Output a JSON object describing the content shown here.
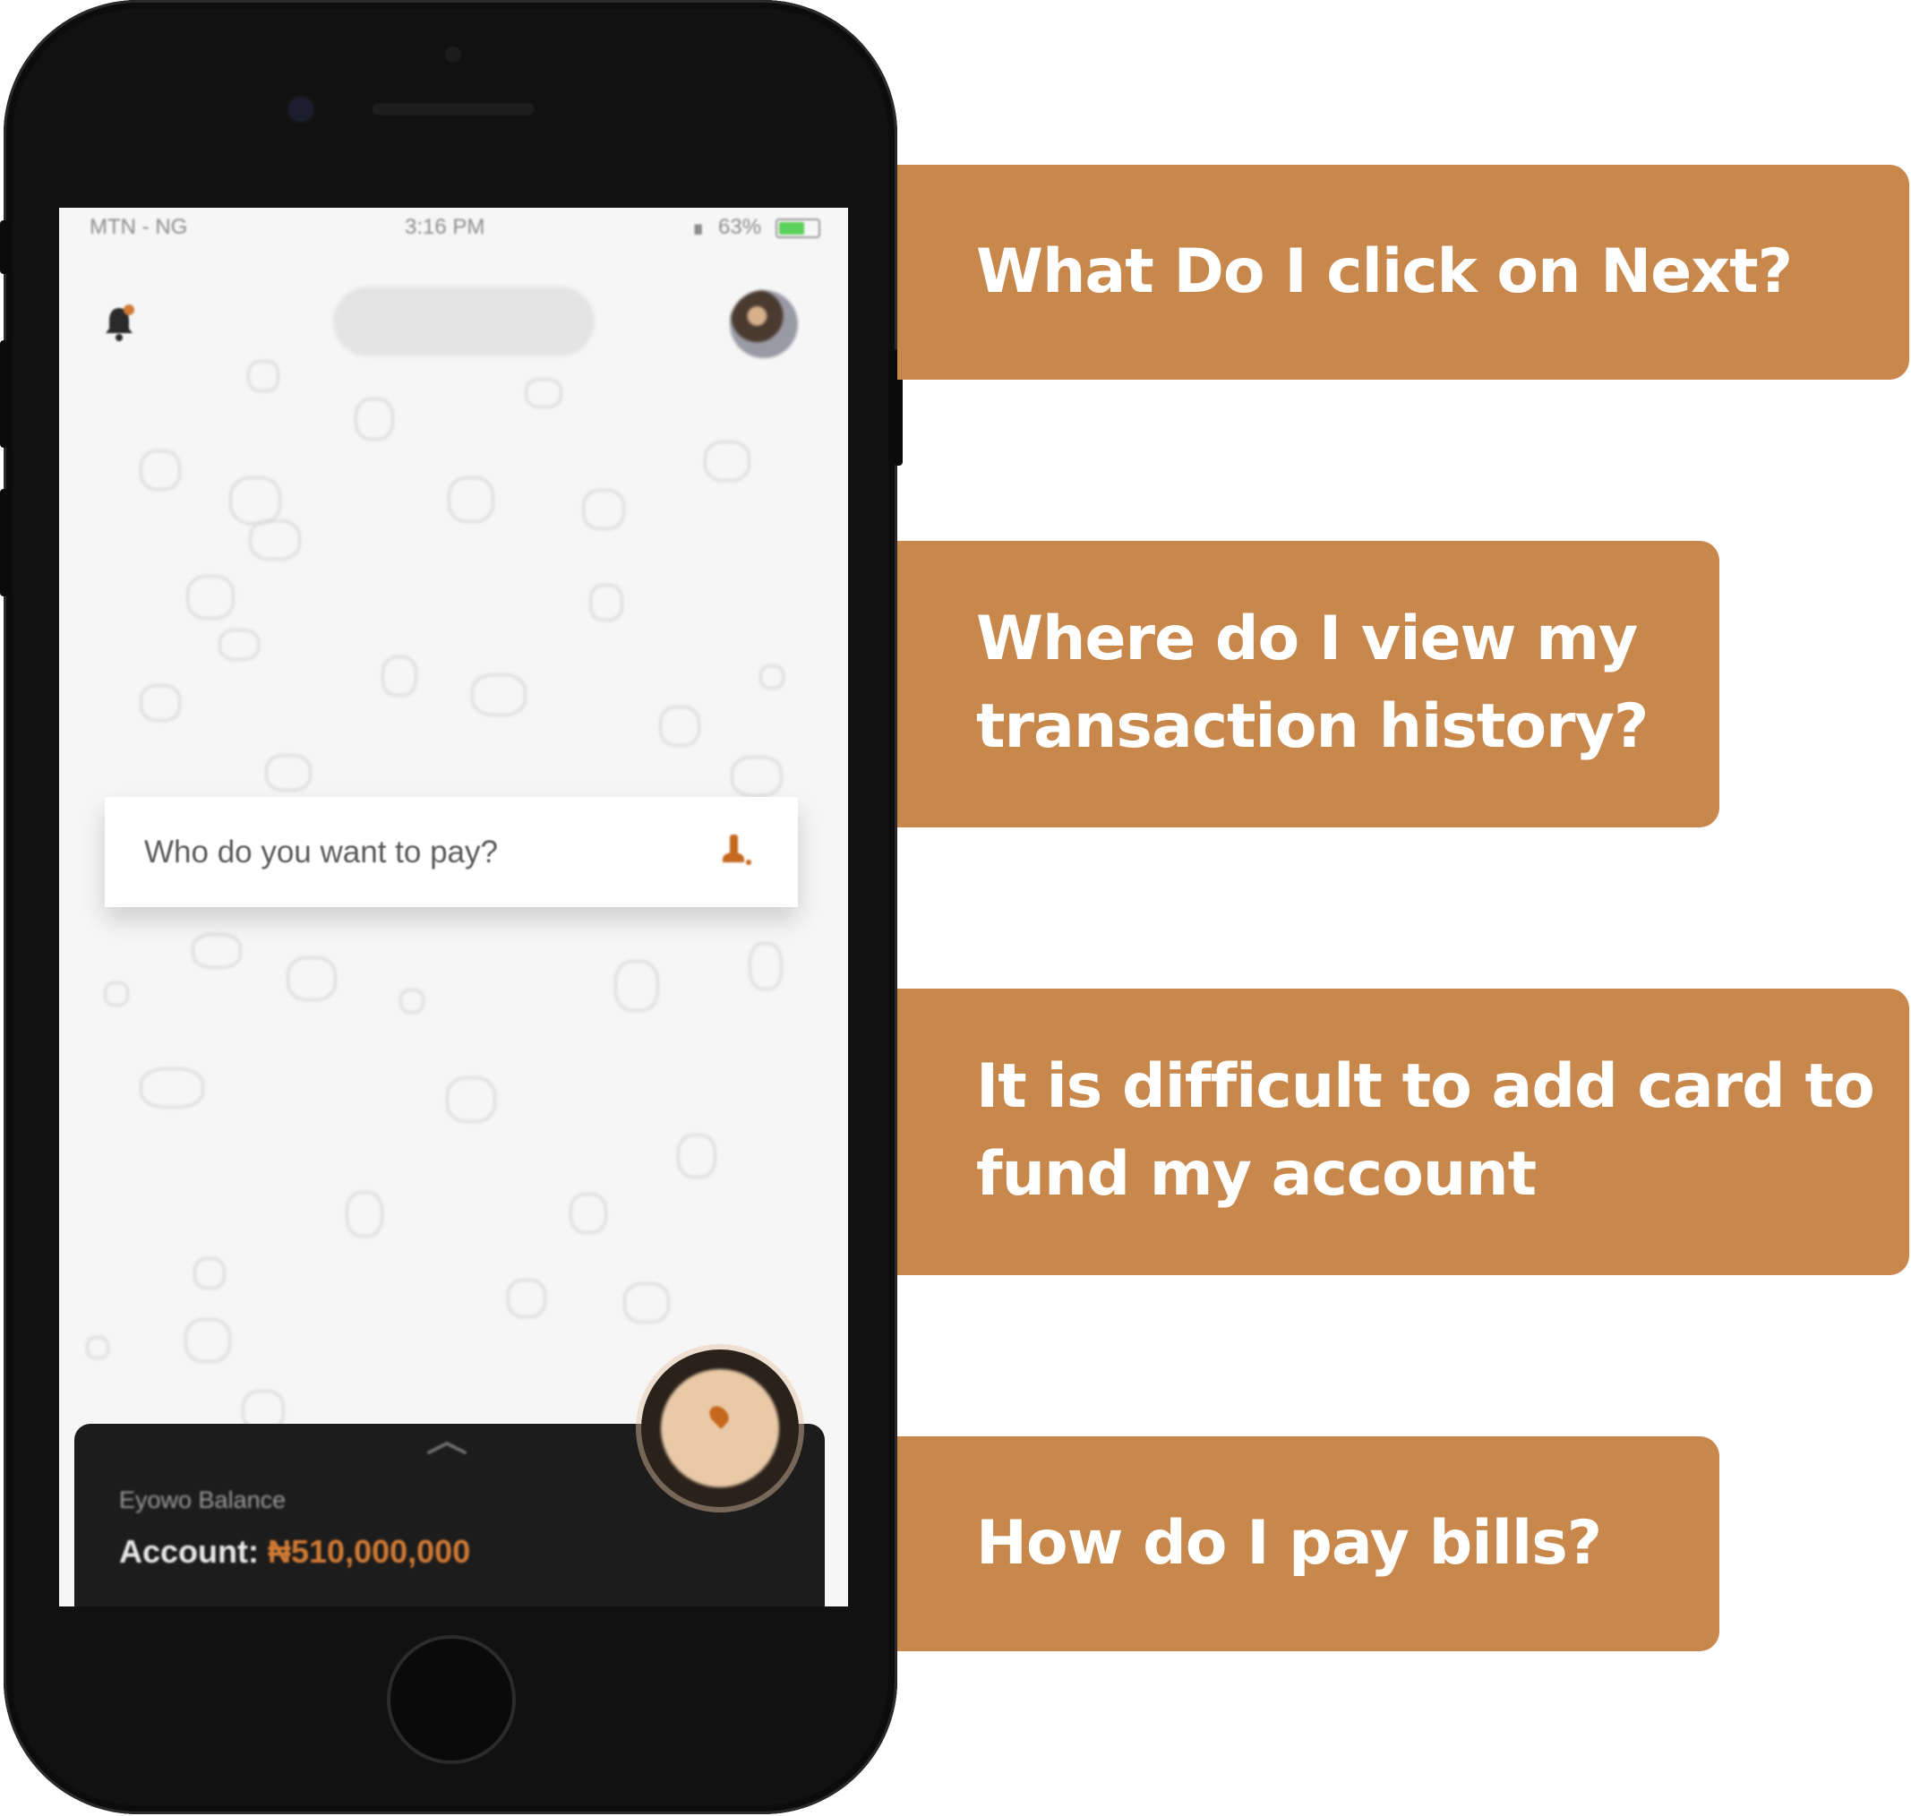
{
  "phone_screen": {
    "status_bar": {
      "carrier": "MTN - NG",
      "time": "3:16 PM",
      "battery": "63%"
    },
    "icons": {
      "notification": "bell-icon",
      "profile": "avatar",
      "pay": "person-pay-icon",
      "expand": "chevron-up-icon",
      "fab": "map-pin-icon"
    },
    "search": {
      "placeholder": "Who do you want to pay?"
    },
    "balance": {
      "label": "Eyowo Balance",
      "account_label": "Account:",
      "account_value": "₦510,000,000"
    }
  },
  "feedback": {
    "items": [
      {
        "lines": [
          "What Do I click on Next?"
        ]
      },
      {
        "lines": [
          "Where do I view my",
          "transaction history?"
        ]
      },
      {
        "lines": [
          "It is difficult to add card to",
          "fund my account"
        ]
      },
      {
        "lines": [
          "How do I pay bills?"
        ]
      }
    ]
  },
  "colors": {
    "accent": "#c8874b",
    "brand_orange": "#d07a35",
    "panel_dark": "#1c1c1c",
    "screen_bg": "#f6f6f6"
  }
}
